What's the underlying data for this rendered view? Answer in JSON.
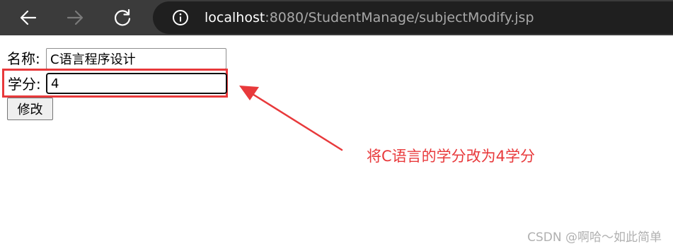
{
  "browser": {
    "url_host": "localhost",
    "url_path": ":8080/StudentManage/subjectModify.jsp",
    "icons": {
      "back": "back-arrow-icon",
      "forward": "forward-arrow-icon",
      "reload": "reload-icon",
      "info": "info-icon"
    },
    "colors": {
      "toolbar_bg": "#3b3b3b",
      "address_bg": "#1f1f1f",
      "host_text": "#ffffff",
      "path_text": "#a8a8a8"
    }
  },
  "form": {
    "name_label": "名称:",
    "name_value": "C语言程序设计",
    "credit_label": "学分:",
    "credit_value": "4",
    "modify_button": "修改"
  },
  "annotation": {
    "text": "将C语言的学分改为4学分",
    "color": "#e8393b"
  },
  "watermark": "CSDN @啊哈～如此简单"
}
